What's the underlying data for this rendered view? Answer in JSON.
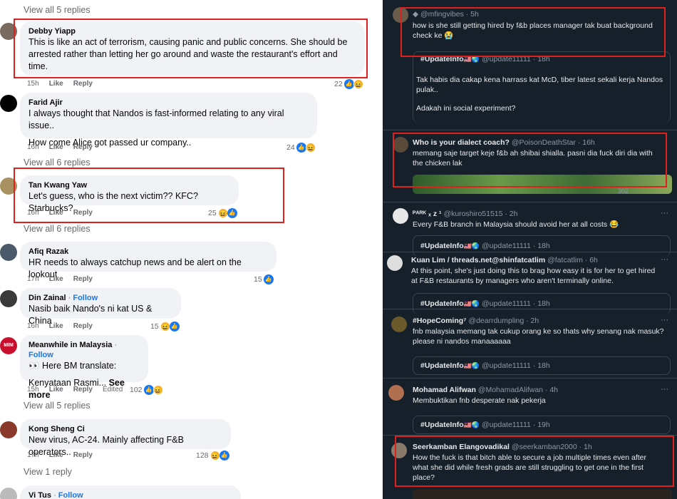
{
  "facebook": {
    "view_replies": [
      {
        "label": "View all 5 replies"
      },
      {
        "label": "View all 6 replies"
      },
      {
        "label": "View all 6 replies"
      },
      {
        "label": "View all 5 replies"
      },
      {
        "label": "View 1 reply"
      }
    ],
    "comments": [
      {
        "name": "Debby Yiapp",
        "follow": "",
        "text": [
          "This is like an act of terrorism, causing panic and public concerns. She should be",
          "arrested rather than letting her go around and waste the restaurant's effort and",
          "time."
        ],
        "time": "15h",
        "like": "Like",
        "reply": "Reply",
        "edited": "",
        "reactions": "22"
      },
      {
        "name": "Farid Ajir",
        "follow": "",
        "text": [
          "I always thought that Nandos is fast-informed relating to any viral issue..",
          "",
          "How come Alice got passed ur company.."
        ],
        "time": "16h",
        "like": "Like",
        "reply": "Reply",
        "edited": "",
        "reactions": "24"
      },
      {
        "name": "Tan Kwang Yaw",
        "follow": "",
        "text": [
          "Let's guess, who is the next victim?? KFC? Starbucks?"
        ],
        "time": "16h",
        "like": "Like",
        "reply": "Reply",
        "edited": "",
        "reactions": "25"
      },
      {
        "name": "Afiq Razak",
        "follow": "",
        "text": [
          "HR needs to always catchup news and be alert on the lookout"
        ],
        "time": "17h",
        "like": "Like",
        "reply": "Reply",
        "edited": "",
        "reactions": "15"
      },
      {
        "name": "Din Zainal",
        "follow": "Follow",
        "text": [
          "Nasib baik Nando's ni kat US & China"
        ],
        "time": "16h",
        "like": "Like",
        "reply": "Reply",
        "edited": "",
        "reactions": "15"
      },
      {
        "name": "Meanwhile in Malaysia",
        "follow": "Follow",
        "text": [
          "👀 Here BM translate:",
          "",
          "Kenyataan Rasmi..."
        ],
        "see_more": "See more",
        "time": "15h",
        "like": "Like",
        "reply": "Reply",
        "edited": "Edited",
        "reactions": "102"
      },
      {
        "name": "Kong Sheng Ci",
        "follow": "",
        "text": [
          "New virus, AC-24. Mainly affecting F&B operators.."
        ],
        "time": "17h",
        "like": "Like",
        "reply": "Reply",
        "edited": "",
        "reactions": "128"
      },
      {
        "name": "Vi Tus",
        "follow": "Follow",
        "text": [],
        "time": "",
        "like": "",
        "reply": "",
        "edited": "",
        "reactions": ""
      }
    ],
    "follow_sep": "·",
    "avatar_text_mim": "MIM"
  },
  "twitter": {
    "tweets": [
      {
        "name": "",
        "handle": "◆ @mfingvibes · 5h",
        "text": [
          "how is she still getting hired by f&b places manager tak buat background",
          "check ke 😭"
        ],
        "quote_name": "#UpdateInfo",
        "quote_handle": "@update11111 · 18h",
        "quote_text": [
          "Tak habis dia cakap kena harrass kat McD, tiber latest sekali kerja Nandos",
          "pulak..",
          "",
          "Adakah ini social experiment?"
        ]
      },
      {
        "name": "Who is your dialect coach?",
        "handle": "@PoisonDeathStar · 16h",
        "text": [
          "memang saje target keje f&b ah shibai shialla. pasni dia fuck diri dia with",
          "the chicken lak"
        ],
        "stat": "302"
      },
      {
        "name": "ᴾᴬᴿᴷ ₓ z ¹",
        "handle": "@kuroshiro51515 · 2h",
        "text": [
          "Every F&B branch in Malaysia should avoid her at all costs 😂"
        ],
        "quote_name": "#UpdateInfo",
        "quote_handle": "@update11111 · 18h"
      },
      {
        "name": "Kuan Lim / threads.net@shinfatcatlim",
        "handle": "@fatcatlim · 6h",
        "text": [
          "At this point, she's just doing this to brag how easy it is for her to get hired",
          "at F&B restaurants by managers who aren't terminally online."
        ],
        "quote_name": "#UpdateInfo",
        "quote_handle": "@update11111 · 18h"
      },
      {
        "name": "#HopeComing⁷",
        "handle": "@dearrdumpling · 2h",
        "text": [
          "fnb malaysia memang tak cukup orang ke so thats why senang nak masuk?",
          "please ni nandos manaaaaaa"
        ],
        "quote_name": "#UpdateInfo",
        "quote_handle": "@update11111 · 18h"
      },
      {
        "name": "Mohamad Alifwan",
        "handle": "@MohamadAlifwan · 4h",
        "text": [
          "Membuktikan fnb desperate nak pekerja"
        ],
        "quote_name": "#UpdateInfo",
        "quote_handle": "@update11111 · 19h"
      },
      {
        "name": "Seerkamban Elangovadikal",
        "handle": "@seerkamban2000 · 1h",
        "text": [
          "How the fuck is that bitch able to secure a job multiple times even after",
          "what she did while fresh grads are still struggling to get one in the first",
          "place?"
        ]
      }
    ],
    "more": "···"
  },
  "colors": {
    "highlight": "#e0201f",
    "fb_link": "#1877f2",
    "tw_bg": "#15202b"
  }
}
